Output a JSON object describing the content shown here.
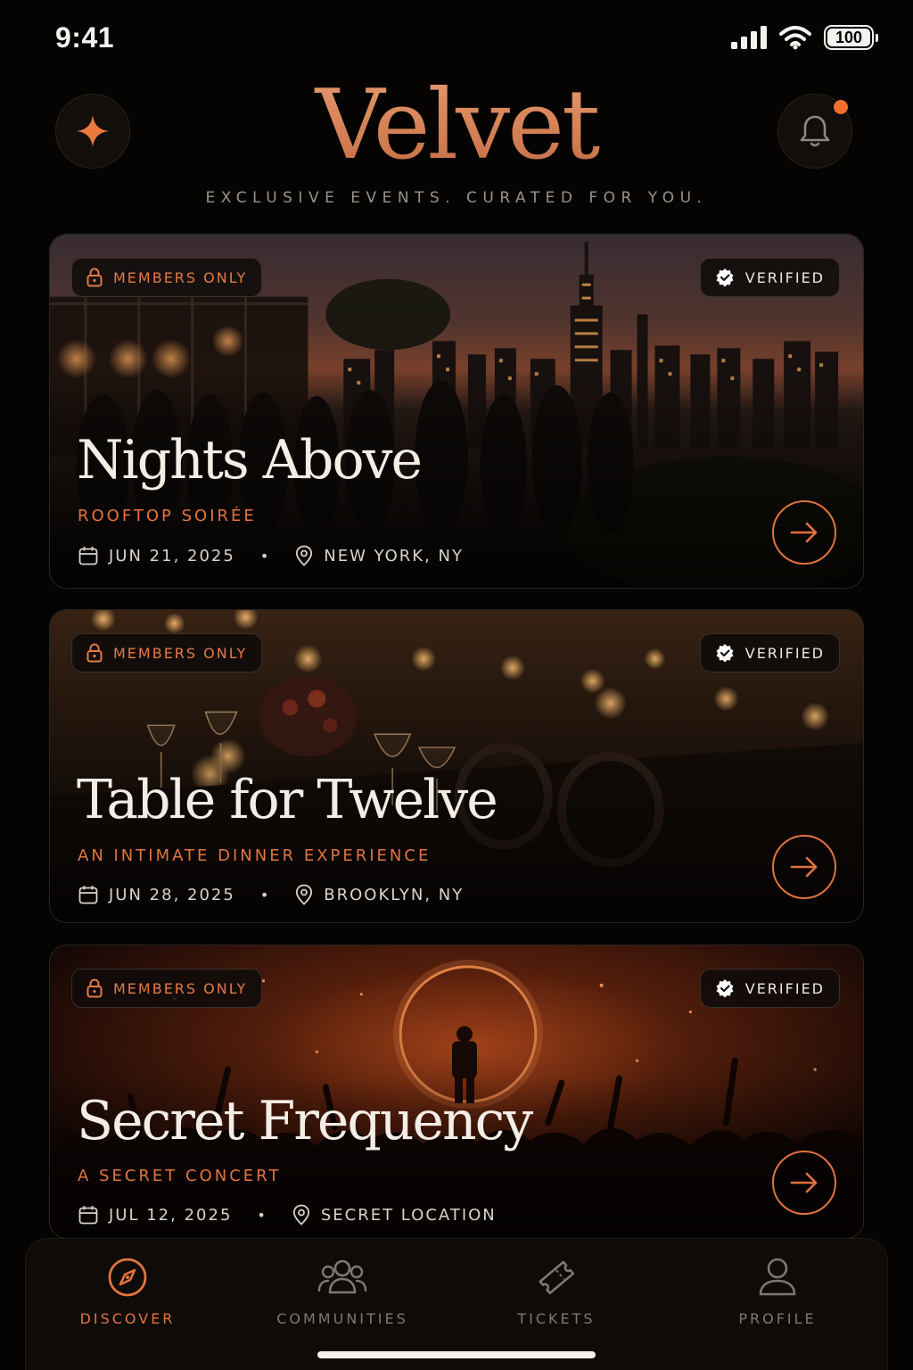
{
  "status_bar": {
    "time": "9:41",
    "battery": "100",
    "icons": [
      "signal-icon",
      "wifi-icon",
      "battery-icon"
    ]
  },
  "header": {
    "brand": "Velvet",
    "tagline": "EXCLUSIVE EVENTS. CURATED FOR YOU.",
    "left_icon": "sparkle-icon",
    "right_icon": "bell-icon",
    "has_notification": true
  },
  "events": [
    {
      "badge": "MEMBERS ONLY",
      "verified": "VERIFIED",
      "title": "Nights Above",
      "subtitle": "ROOFTOP SOIRÉE",
      "date": "JUN 21, 2025",
      "location": "NEW YORK, NY"
    },
    {
      "badge": "MEMBERS ONLY",
      "verified": "VERIFIED",
      "title": "Table for Twelve",
      "subtitle": "AN INTIMATE DINNER EXPERIENCE",
      "date": "JUN 28, 2025",
      "location": "BROOKLYN, NY"
    },
    {
      "badge": "MEMBERS ONLY",
      "verified": "VERIFIED",
      "title": "Secret Frequency",
      "subtitle": "A SECRET CONCERT",
      "date": "JUL 12, 2025",
      "location": "SECRET LOCATION"
    }
  ],
  "nav": {
    "items": [
      {
        "label": "DISCOVER",
        "icon": "compass-icon",
        "active": true
      },
      {
        "label": "COMMUNITIES",
        "icon": "users-icon",
        "active": false
      },
      {
        "label": "TICKETS",
        "icon": "ticket-icon",
        "active": false
      },
      {
        "label": "PROFILE",
        "icon": "user-icon",
        "active": false
      }
    ]
  },
  "colors": {
    "accent": "#e2743f",
    "brand": "#d58258",
    "background": "#050403",
    "card_border": "#2a2520"
  }
}
